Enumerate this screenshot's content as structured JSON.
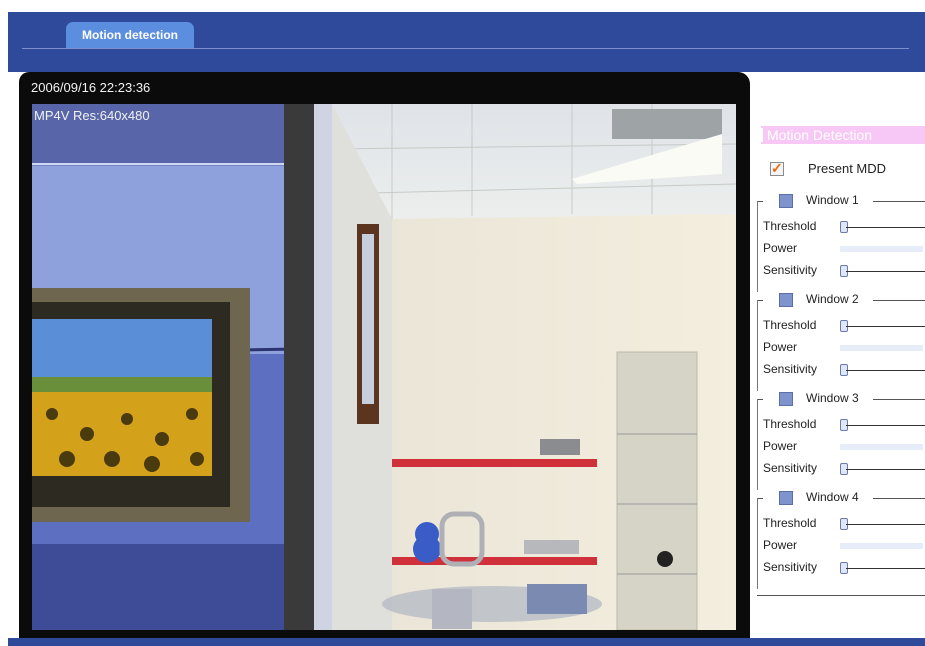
{
  "header": {
    "tab_label": "Motion detection"
  },
  "video": {
    "timestamp": "2006/09/16 22:23:36",
    "codec_res": "MP4V Res:640x480"
  },
  "panel": {
    "title": "Motion Detection",
    "present_label": "Present MDD",
    "present_checked": true,
    "row_labels": {
      "threshold": "Threshold",
      "power": "Power",
      "sensitivity": "Sensitivity"
    },
    "windows": [
      {
        "label": "Window 1",
        "checked": false
      },
      {
        "label": "Window 2",
        "checked": false
      },
      {
        "label": "Window 3",
        "checked": false
      },
      {
        "label": "Window 4",
        "checked": false
      }
    ]
  },
  "colors": {
    "brand_blue": "#2f4a9a",
    "tab_blue": "#5b8ede",
    "title_pink": "#f7c8f5",
    "checkbox_blue": "#7f94cc"
  }
}
